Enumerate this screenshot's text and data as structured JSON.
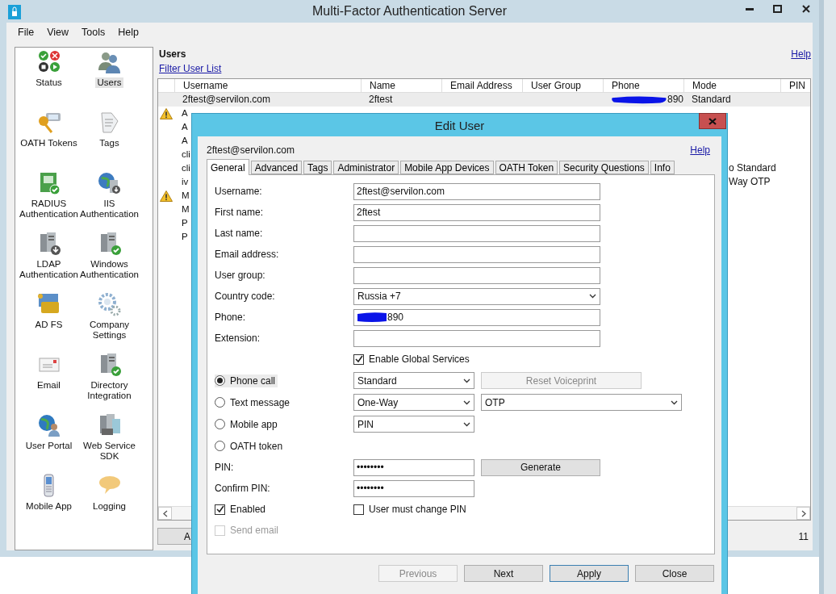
{
  "window": {
    "title": "Multi-Factor Authentication Server"
  },
  "menu": [
    "File",
    "View",
    "Tools",
    "Help"
  ],
  "sidebar": {
    "items": [
      {
        "label": "Status",
        "selected": false
      },
      {
        "label": "Users",
        "selected": true
      },
      {
        "label": "OATH Tokens",
        "selected": false
      },
      {
        "label": "Tags",
        "selected": false
      },
      {
        "label": "RADIUS Authentication",
        "selected": false
      },
      {
        "label": "IIS Authentication",
        "selected": false
      },
      {
        "label": "LDAP Authentication",
        "selected": false
      },
      {
        "label": "Windows Authentication",
        "selected": false
      },
      {
        "label": "AD FS",
        "selected": false
      },
      {
        "label": "Company Settings",
        "selected": false
      },
      {
        "label": "Email",
        "selected": false
      },
      {
        "label": "Directory Integration",
        "selected": false
      },
      {
        "label": "User Portal",
        "selected": false
      },
      {
        "label": "Web Service SDK",
        "selected": false
      },
      {
        "label": "Mobile App",
        "selected": false
      },
      {
        "label": "Logging",
        "selected": false
      }
    ]
  },
  "users": {
    "title": "Users",
    "help": "Help",
    "filter_link": "Filter User List",
    "table": {
      "columns": [
        "Username",
        "Name",
        "Email Address",
        "User Group",
        "Phone",
        "Mode",
        "PIN"
      ],
      "rows": [
        {
          "selected": true,
          "warning": false,
          "username": "2ftest@servilon.com",
          "name": "2ftest",
          "phone": "890",
          "mode": "Standard"
        },
        {
          "selected": false,
          "warning": true,
          "username": "A"
        },
        {
          "selected": false,
          "warning": false,
          "username": "A"
        },
        {
          "selected": false,
          "warning": false,
          "username": "A"
        },
        {
          "selected": false,
          "warning": false,
          "username": "cli"
        },
        {
          "selected": false,
          "warning": false,
          "username": "cli",
          "mode": "o Standard"
        },
        {
          "selected": false,
          "warning": false,
          "username": "iv",
          "mode": "Way OTP"
        },
        {
          "selected": false,
          "warning": true,
          "username": "M"
        },
        {
          "selected": false,
          "warning": false,
          "username": "M"
        },
        {
          "selected": false,
          "warning": false,
          "username": "P"
        },
        {
          "selected": false,
          "warning": false,
          "username": "P"
        }
      ]
    },
    "bottom_button": "A",
    "count": "11"
  },
  "dialog": {
    "title": "Edit User",
    "user": "2ftest@servilon.com",
    "help": "Help",
    "tabs": [
      {
        "label": "General",
        "selected": true
      },
      {
        "label": "Advanced",
        "selected": false
      },
      {
        "label": "Tags",
        "selected": false
      },
      {
        "label": "Administrator",
        "selected": false
      },
      {
        "label": "Mobile App Devices",
        "selected": false
      },
      {
        "label": "OATH Token",
        "selected": false
      },
      {
        "label": "Security Questions",
        "selected": false
      },
      {
        "label": "Info",
        "selected": false
      }
    ],
    "fields": [
      {
        "kind": "text",
        "label": "Username:",
        "value": "2ftest@servilon.com"
      },
      {
        "kind": "text",
        "label": "First name:",
        "value": "2ftest"
      },
      {
        "kind": "text",
        "label": "Last name:"
      },
      {
        "kind": "text",
        "label": "Email address:"
      },
      {
        "kind": "text",
        "label": "User group:"
      },
      {
        "kind": "select",
        "label": "Country code:",
        "value": "Russia +7"
      },
      {
        "kind": "phone",
        "label": "Phone:",
        "value": "890"
      },
      {
        "kind": "text",
        "label": "Extension:"
      }
    ],
    "global_services": {
      "label": "Enable Global Services",
      "checked": true
    },
    "methods": [
      {
        "label": "Phone call",
        "selected": true,
        "controls": [
          {
            "kind": "select",
            "value": "Standard"
          },
          {
            "kind": "button",
            "label": "Reset Voiceprint",
            "disabled": true
          }
        ]
      },
      {
        "label": "Text message",
        "selected": false,
        "controls": [
          {
            "kind": "select",
            "value": "One-Way"
          },
          {
            "kind": "select",
            "value": "OTP"
          }
        ]
      },
      {
        "label": "Mobile app",
        "selected": false,
        "controls": [
          {
            "kind": "select",
            "value": "PIN"
          }
        ]
      },
      {
        "label": "OATH token",
        "selected": false
      }
    ],
    "pin": {
      "label": "PIN:",
      "value": "••••••••",
      "button": "Generate"
    },
    "confirm_pin": {
      "label": "Confirm PIN:",
      "value": "••••••••"
    },
    "enabled": {
      "label": "Enabled",
      "checked": true,
      "disabled": false
    },
    "must_change": {
      "label": "User must change PIN",
      "checked": false,
      "disabled": false
    },
    "send_email": {
      "label": "Send email",
      "checked": false,
      "disabled": true
    },
    "buttons": [
      {
        "label": "Previous",
        "disabled": true,
        "focused": false
      },
      {
        "label": "Next",
        "disabled": false,
        "focused": false
      },
      {
        "label": "Apply",
        "disabled": false,
        "focused": true
      },
      {
        "label": "Close",
        "disabled": false,
        "focused": false
      }
    ]
  }
}
